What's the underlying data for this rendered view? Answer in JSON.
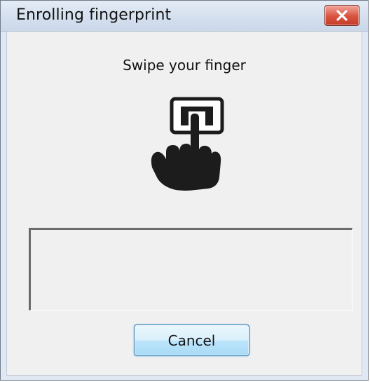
{
  "window": {
    "title": "Enrolling fingerprint"
  },
  "titlebar": {
    "close_icon": "close-icon",
    "close_color": "#d9533f"
  },
  "dialog": {
    "instruction": "Swipe your finger",
    "icon": "finger-swipe-icon",
    "status_text": "",
    "cancel_label": "Cancel"
  }
}
